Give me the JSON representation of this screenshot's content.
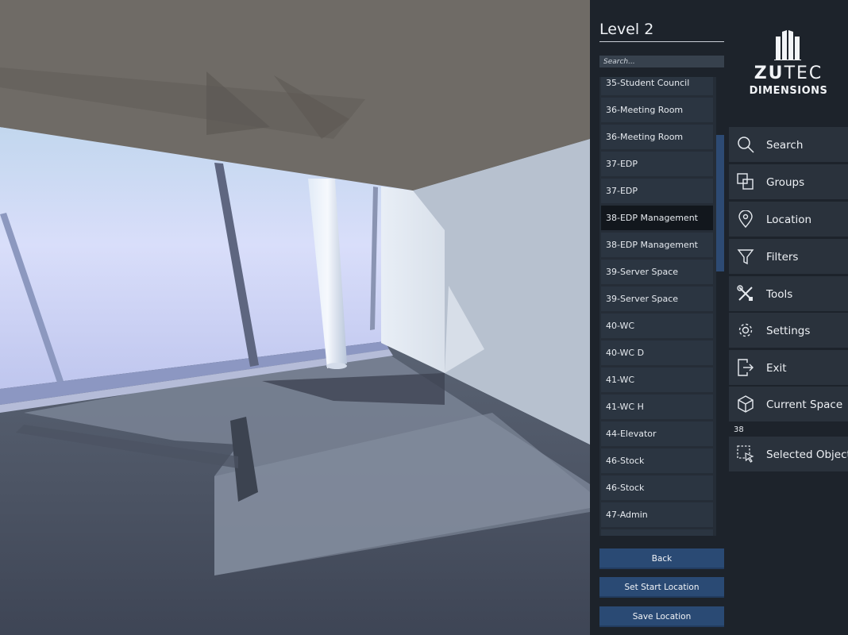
{
  "level": {
    "title": "Level 2"
  },
  "search": {
    "placeholder": "Search..."
  },
  "rooms": [
    {
      "label": "35-Student Council",
      "selected": false
    },
    {
      "label": "36-Meeting Room",
      "selected": false
    },
    {
      "label": "36-Meeting Room",
      "selected": false
    },
    {
      "label": "37-EDP",
      "selected": false
    },
    {
      "label": "37-EDP",
      "selected": false
    },
    {
      "label": "38-EDP Management",
      "selected": true
    },
    {
      "label": "38-EDP Management",
      "selected": false
    },
    {
      "label": "39-Server Space",
      "selected": false
    },
    {
      "label": "39-Server Space",
      "selected": false
    },
    {
      "label": "40-WC",
      "selected": false
    },
    {
      "label": "40-WC D",
      "selected": false
    },
    {
      "label": "41-WC",
      "selected": false
    },
    {
      "label": "41-WC H",
      "selected": false
    },
    {
      "label": "44-Elevator",
      "selected": false
    },
    {
      "label": "46-Stock",
      "selected": false
    },
    {
      "label": "46-Stock",
      "selected": false
    },
    {
      "label": "47-Admin",
      "selected": false
    },
    {
      "label": "",
      "selected": false
    }
  ],
  "actions": {
    "back": "Back",
    "set_start": "Set Start Location",
    "save": "Save Location"
  },
  "brand": {
    "name_bold": "ZU",
    "name_thin": "TEC",
    "subtitle": "DIMENSIONS"
  },
  "menu": {
    "search": "Search",
    "groups": "Groups",
    "location": "Location",
    "filters": "Filters",
    "tools": "Tools",
    "settings": "Settings",
    "exit": "Exit",
    "current_space": "Current Space",
    "selected_object": "Selected Object"
  },
  "current_space": {
    "number": "38"
  },
  "colors": {
    "panel_bg": "#1d232b",
    "menu_bg": "#2a323c",
    "list_item_bg": "#2b3541",
    "list_selected_bg": "#12171d",
    "button_bg": "#2a4a74",
    "accent_scroll": "#2d4a73"
  }
}
